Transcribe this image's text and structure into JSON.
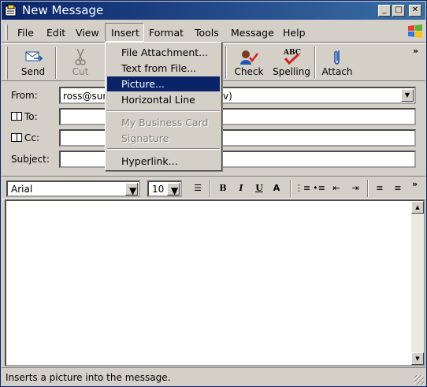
{
  "window": {
    "title": "New Message"
  },
  "menubar": {
    "items": [
      "File",
      "Edit",
      "View",
      "Insert",
      "Format",
      "Tools",
      "Message",
      "Help"
    ]
  },
  "toolbar": {
    "send": "Send",
    "cut": "Cut",
    "check": "Check",
    "spelling": "Spelling",
    "attach": "Attach",
    "more": "»"
  },
  "headers": {
    "from_label": "From:",
    "from_value": "ross@sun",
    "from_value_tail": "v)",
    "to_label": "To:",
    "cc_label": "Cc:",
    "subject_label": "Subject:"
  },
  "format_bar": {
    "font": "Arial",
    "size": "10",
    "more": "»"
  },
  "insert_menu": {
    "items": [
      "File Attachment...",
      "Text from File...",
      "Picture...",
      "Horizontal Line",
      "My Business Card",
      "Signature",
      "Hyperlink..."
    ],
    "selected": "Picture..."
  },
  "status": {
    "text": "Inserts a picture into the message."
  },
  "colors": {
    "title_bar": "#0a246a",
    "highlight": "#0a246a",
    "face": "#d4d0c8"
  }
}
